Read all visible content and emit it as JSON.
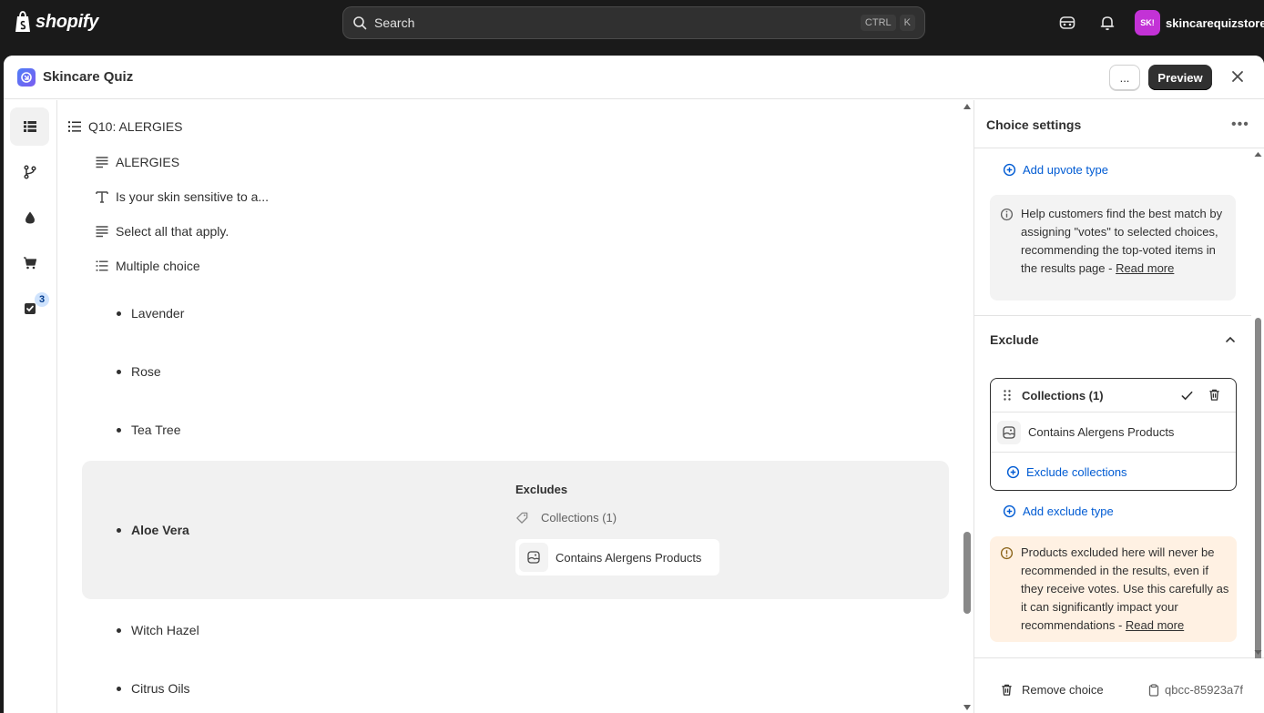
{
  "topbar": {
    "brand": "shopify",
    "search_placeholder": "Search",
    "shortcut_ctrl": "CTRL",
    "shortcut_key": "K",
    "store_avatar": "SK!",
    "store_name": "skincarequizstore"
  },
  "window": {
    "title": "Skincare Quiz",
    "more_label": "...",
    "preview_label": "Preview"
  },
  "rail": {
    "items": [
      "list-icon",
      "branch-icon",
      "drop-icon",
      "cart-icon",
      "checklist-icon"
    ],
    "badge_count": "3"
  },
  "tree": {
    "question": "Q10: ALERGIES",
    "heading": "ALERGIES",
    "text": "Is your skin sensitive to a...",
    "subtext": "Select all that apply.",
    "type": "Multiple choice",
    "choices": [
      "Lavender",
      "Rose",
      "Tea Tree",
      "Aloe Vera",
      "Witch Hazel",
      "Citrus Oils"
    ],
    "selected": {
      "excludes_title": "Excludes",
      "collections_label": "Collections (1)",
      "item": "Contains Alergens Products"
    }
  },
  "panel": {
    "title": "Choice settings",
    "add_upvote": "Add upvote type",
    "info_text": "Help customers find the best match by assigning \"votes\" to selected choices, recommending the top-voted items in the results page - ",
    "read_more": "Read more",
    "exclude_title": "Exclude",
    "collections_title": "Collections (1)",
    "collection_item": "Contains Alergens Products",
    "exclude_collections": "Exclude collections",
    "add_exclude": "Add exclude type",
    "warn_text": "Products excluded here will never be recommended in the results, even if they receive votes. Use this carefully as it can significantly impact your recommendations - ",
    "warn_read_more": "Read more",
    "remove_choice": "Remove choice",
    "choice_id": "qbcc-85923a7f"
  },
  "colors": {
    "accent": "#005bd3",
    "topbar": "#1a1a1a",
    "selected_bg": "#f1f1f1",
    "warning_bg": "#fff1e3",
    "avatar": "#c332d6"
  }
}
